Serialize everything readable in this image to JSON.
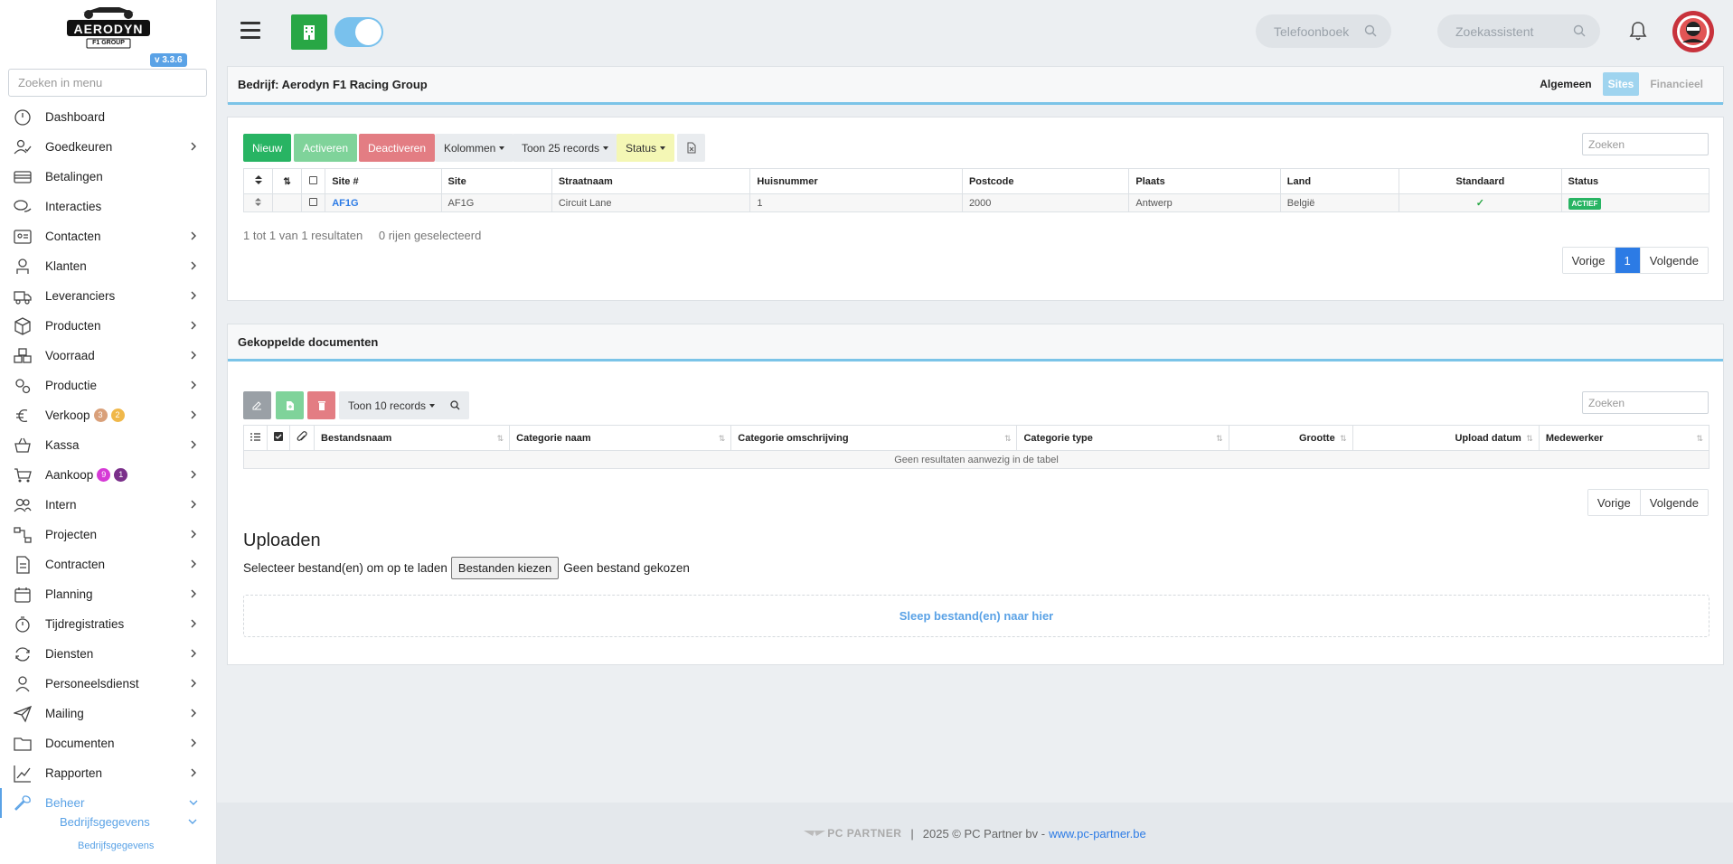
{
  "sidebar": {
    "logo_text": "AERODYN",
    "logo_sub": "F1 GROUP",
    "version": "v 3.3.6",
    "search_placeholder": "Zoeken in menu",
    "items": [
      {
        "label": "Dashboard",
        "icon": "dashboard-icon",
        "chevron": false
      },
      {
        "label": "Goedkeuren",
        "icon": "user-check-icon",
        "chevron": true
      },
      {
        "label": "Betalingen",
        "icon": "credit-card-icon",
        "chevron": false
      },
      {
        "label": "Interacties",
        "icon": "chat-icon",
        "chevron": false
      },
      {
        "label": "Contacten",
        "icon": "contact-card-icon",
        "chevron": true
      },
      {
        "label": "Klanten",
        "icon": "customer-icon",
        "chevron": true
      },
      {
        "label": "Leveranciers",
        "icon": "truck-icon",
        "chevron": true
      },
      {
        "label": "Producten",
        "icon": "box-icon",
        "chevron": true
      },
      {
        "label": "Voorraad",
        "icon": "boxes-icon",
        "chevron": true
      },
      {
        "label": "Productie",
        "icon": "gears-icon",
        "chevron": true
      },
      {
        "label": "Verkoop",
        "icon": "euro-icon",
        "chevron": true,
        "badges": [
          {
            "value": "3",
            "color": "#d9a07a"
          },
          {
            "value": "2",
            "color": "#f0b84a"
          }
        ]
      },
      {
        "label": "Kassa",
        "icon": "basket-icon",
        "chevron": true
      },
      {
        "label": "Aankoop",
        "icon": "cart-icon",
        "chevron": true,
        "badges": [
          {
            "value": "9",
            "color": "#d63ad6"
          },
          {
            "value": "1",
            "color": "#7a2f8a"
          }
        ]
      },
      {
        "label": "Intern",
        "icon": "users-icon",
        "chevron": true
      },
      {
        "label": "Projecten",
        "icon": "project-icon",
        "chevron": true
      },
      {
        "label": "Contracten",
        "icon": "contract-icon",
        "chevron": true
      },
      {
        "label": "Planning",
        "icon": "calendar-icon",
        "chevron": true
      },
      {
        "label": "Tijdregistraties",
        "icon": "timer-icon",
        "chevron": true
      },
      {
        "label": "Diensten",
        "icon": "refresh-icon",
        "chevron": true
      },
      {
        "label": "Personeelsdienst",
        "icon": "person-icon",
        "chevron": true
      },
      {
        "label": "Mailing",
        "icon": "paper-plane-icon",
        "chevron": true
      },
      {
        "label": "Documenten",
        "icon": "folder-icon",
        "chevron": true
      },
      {
        "label": "Rapporten",
        "icon": "chart-icon",
        "chevron": true
      },
      {
        "label": "Beheer",
        "icon": "wrench-icon",
        "chevron": true,
        "active": true
      }
    ],
    "sub_item": "Bedrijfsgegevens",
    "sub_sub_item": "Bedrijfsgegevens"
  },
  "topbar": {
    "phonebook_placeholder": "Telefoonboek",
    "assistant_placeholder": "Zoekassistent"
  },
  "company_card": {
    "title": "Bedrijf: Aerodyn F1 Racing Group",
    "tabs": [
      "Algemeen",
      "Sites",
      "Financieel"
    ],
    "active_tab": "Sites"
  },
  "sites": {
    "buttons": {
      "new": "Nieuw",
      "activate": "Activeren",
      "deactivate": "Deactiveren",
      "columns": "Kolommen",
      "show": "Toon 25 records",
      "status": "Status"
    },
    "search_placeholder": "Zoeken",
    "columns": [
      "Site #",
      "Site",
      "Straatnaam",
      "Huisnummer",
      "Postcode",
      "Plaats",
      "Land",
      "Standaard",
      "Status"
    ],
    "rows": [
      {
        "site_nr": "AF1G",
        "site": "AF1G",
        "street": "Circuit Lane",
        "number": "1",
        "postcode": "2000",
        "city": "Antwerp",
        "country": "België",
        "default": "✓",
        "status": "ACTIEF"
      }
    ],
    "info": "1 tot 1 van 1 resultaten",
    "selected": "0 rijen geselecteerd",
    "pager": {
      "prev": "Vorige",
      "page": "1",
      "next": "Volgende"
    }
  },
  "documents": {
    "title": "Gekoppelde documenten",
    "show": "Toon 10 records",
    "search_placeholder": "Zoeken",
    "columns": [
      "Bestandsnaam",
      "Categorie naam",
      "Categorie omschrijving",
      "Categorie type",
      "Grootte",
      "Upload datum",
      "Medewerker"
    ],
    "empty": "Geen resultaten aanwezig in de tabel",
    "pager": {
      "prev": "Vorige",
      "next": "Volgende"
    },
    "upload_title": "Uploaden",
    "upload_label": "Selecteer bestand(en) om op te laden",
    "choose_button": "Bestanden kiezen",
    "no_file": "Geen bestand gekozen",
    "dropzone": "Sleep bestand(en) naar hier"
  },
  "footer": {
    "brand": "PC PARTNER",
    "separator": "|",
    "copyright": "2025 © PC Partner bv -",
    "link": "www.pc-partner.be"
  }
}
